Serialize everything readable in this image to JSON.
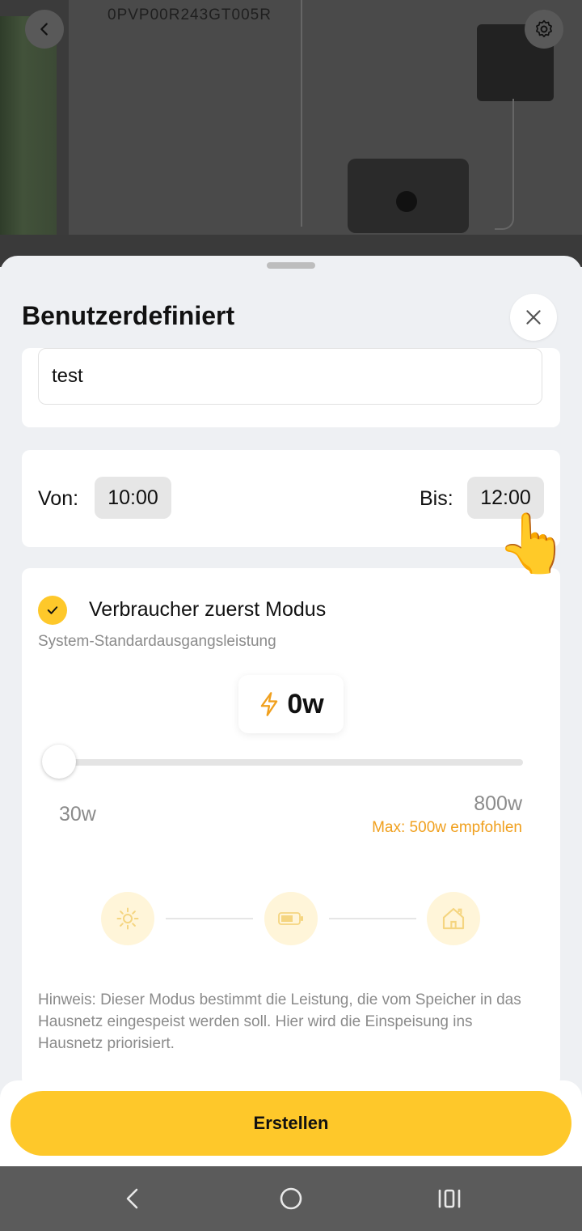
{
  "device": {
    "serial": "0PVP00R243GT005R"
  },
  "sheet": {
    "title": "Benutzerdefiniert"
  },
  "name_field": {
    "value": "test"
  },
  "schedule": {
    "from_label": "Von:",
    "from_time": "10:00",
    "to_label": "Bis:",
    "to_time": "12:00"
  },
  "mode": {
    "checked": true,
    "label": "Verbraucher zuerst Modus",
    "subtitle": "System-Standardausgangsleistung",
    "power_value": "0w",
    "slider": {
      "min_label": "30w",
      "max_label": "800w",
      "recommendation": "Max: 500w empfohlen",
      "position_fraction": 0
    },
    "flow_icons": [
      "sun-icon",
      "battery-icon",
      "home-icon"
    ],
    "hint": "Hinweis: Dieser Modus bestimmt die Leistung, die vom Speicher in das Hausnetz eingespeist werden soll. Hier wird die Einspeisung ins Hausnetz priorisiert."
  },
  "actions": {
    "create_label": "Erstellen"
  },
  "colors": {
    "accent": "#fec82a",
    "recommendation": "#f0a01e",
    "navbar": "#5b5b5b"
  },
  "navbar": {
    "icons": [
      "back-nav-icon",
      "home-nav-icon",
      "recents-nav-icon"
    ]
  }
}
